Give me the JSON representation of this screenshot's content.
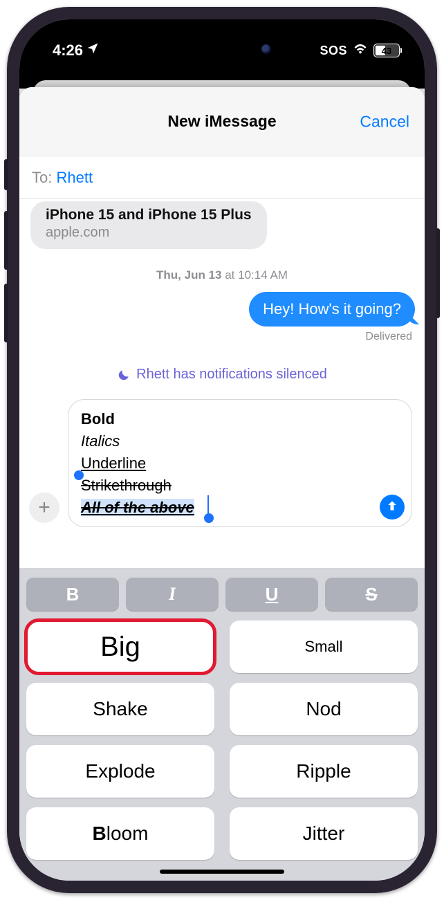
{
  "status": {
    "time": "4:26",
    "sos": "SOS",
    "battery": "43"
  },
  "nav": {
    "title": "New iMessage",
    "cancel": "Cancel"
  },
  "to": {
    "label": "To:",
    "name": "Rhett"
  },
  "link": {
    "title": "iPhone 15 and iPhone 15 Plus",
    "host": "apple.com"
  },
  "timestamp": {
    "day": "Thu, Jun 13",
    "at": " at 10:14 AM"
  },
  "sent": {
    "text": "Hey! How's it going?",
    "status": "Delivered"
  },
  "silenced": "Rhett has notifications silenced",
  "compose": {
    "line1": "Bold",
    "line2": "Italics",
    "line3": "Underline",
    "line4": "Strikethrough",
    "line5": "All of the above"
  },
  "fmt": {
    "b": "B",
    "i": "I",
    "u": "U",
    "s": "S"
  },
  "fx": {
    "big": "Big",
    "small": "Small",
    "shake": "Shake",
    "nod": "Nod",
    "explode": "Explode",
    "ripple": "Ripple",
    "bloom_b": "B",
    "bloom_rest": "loom",
    "jitter": "Jitter"
  }
}
